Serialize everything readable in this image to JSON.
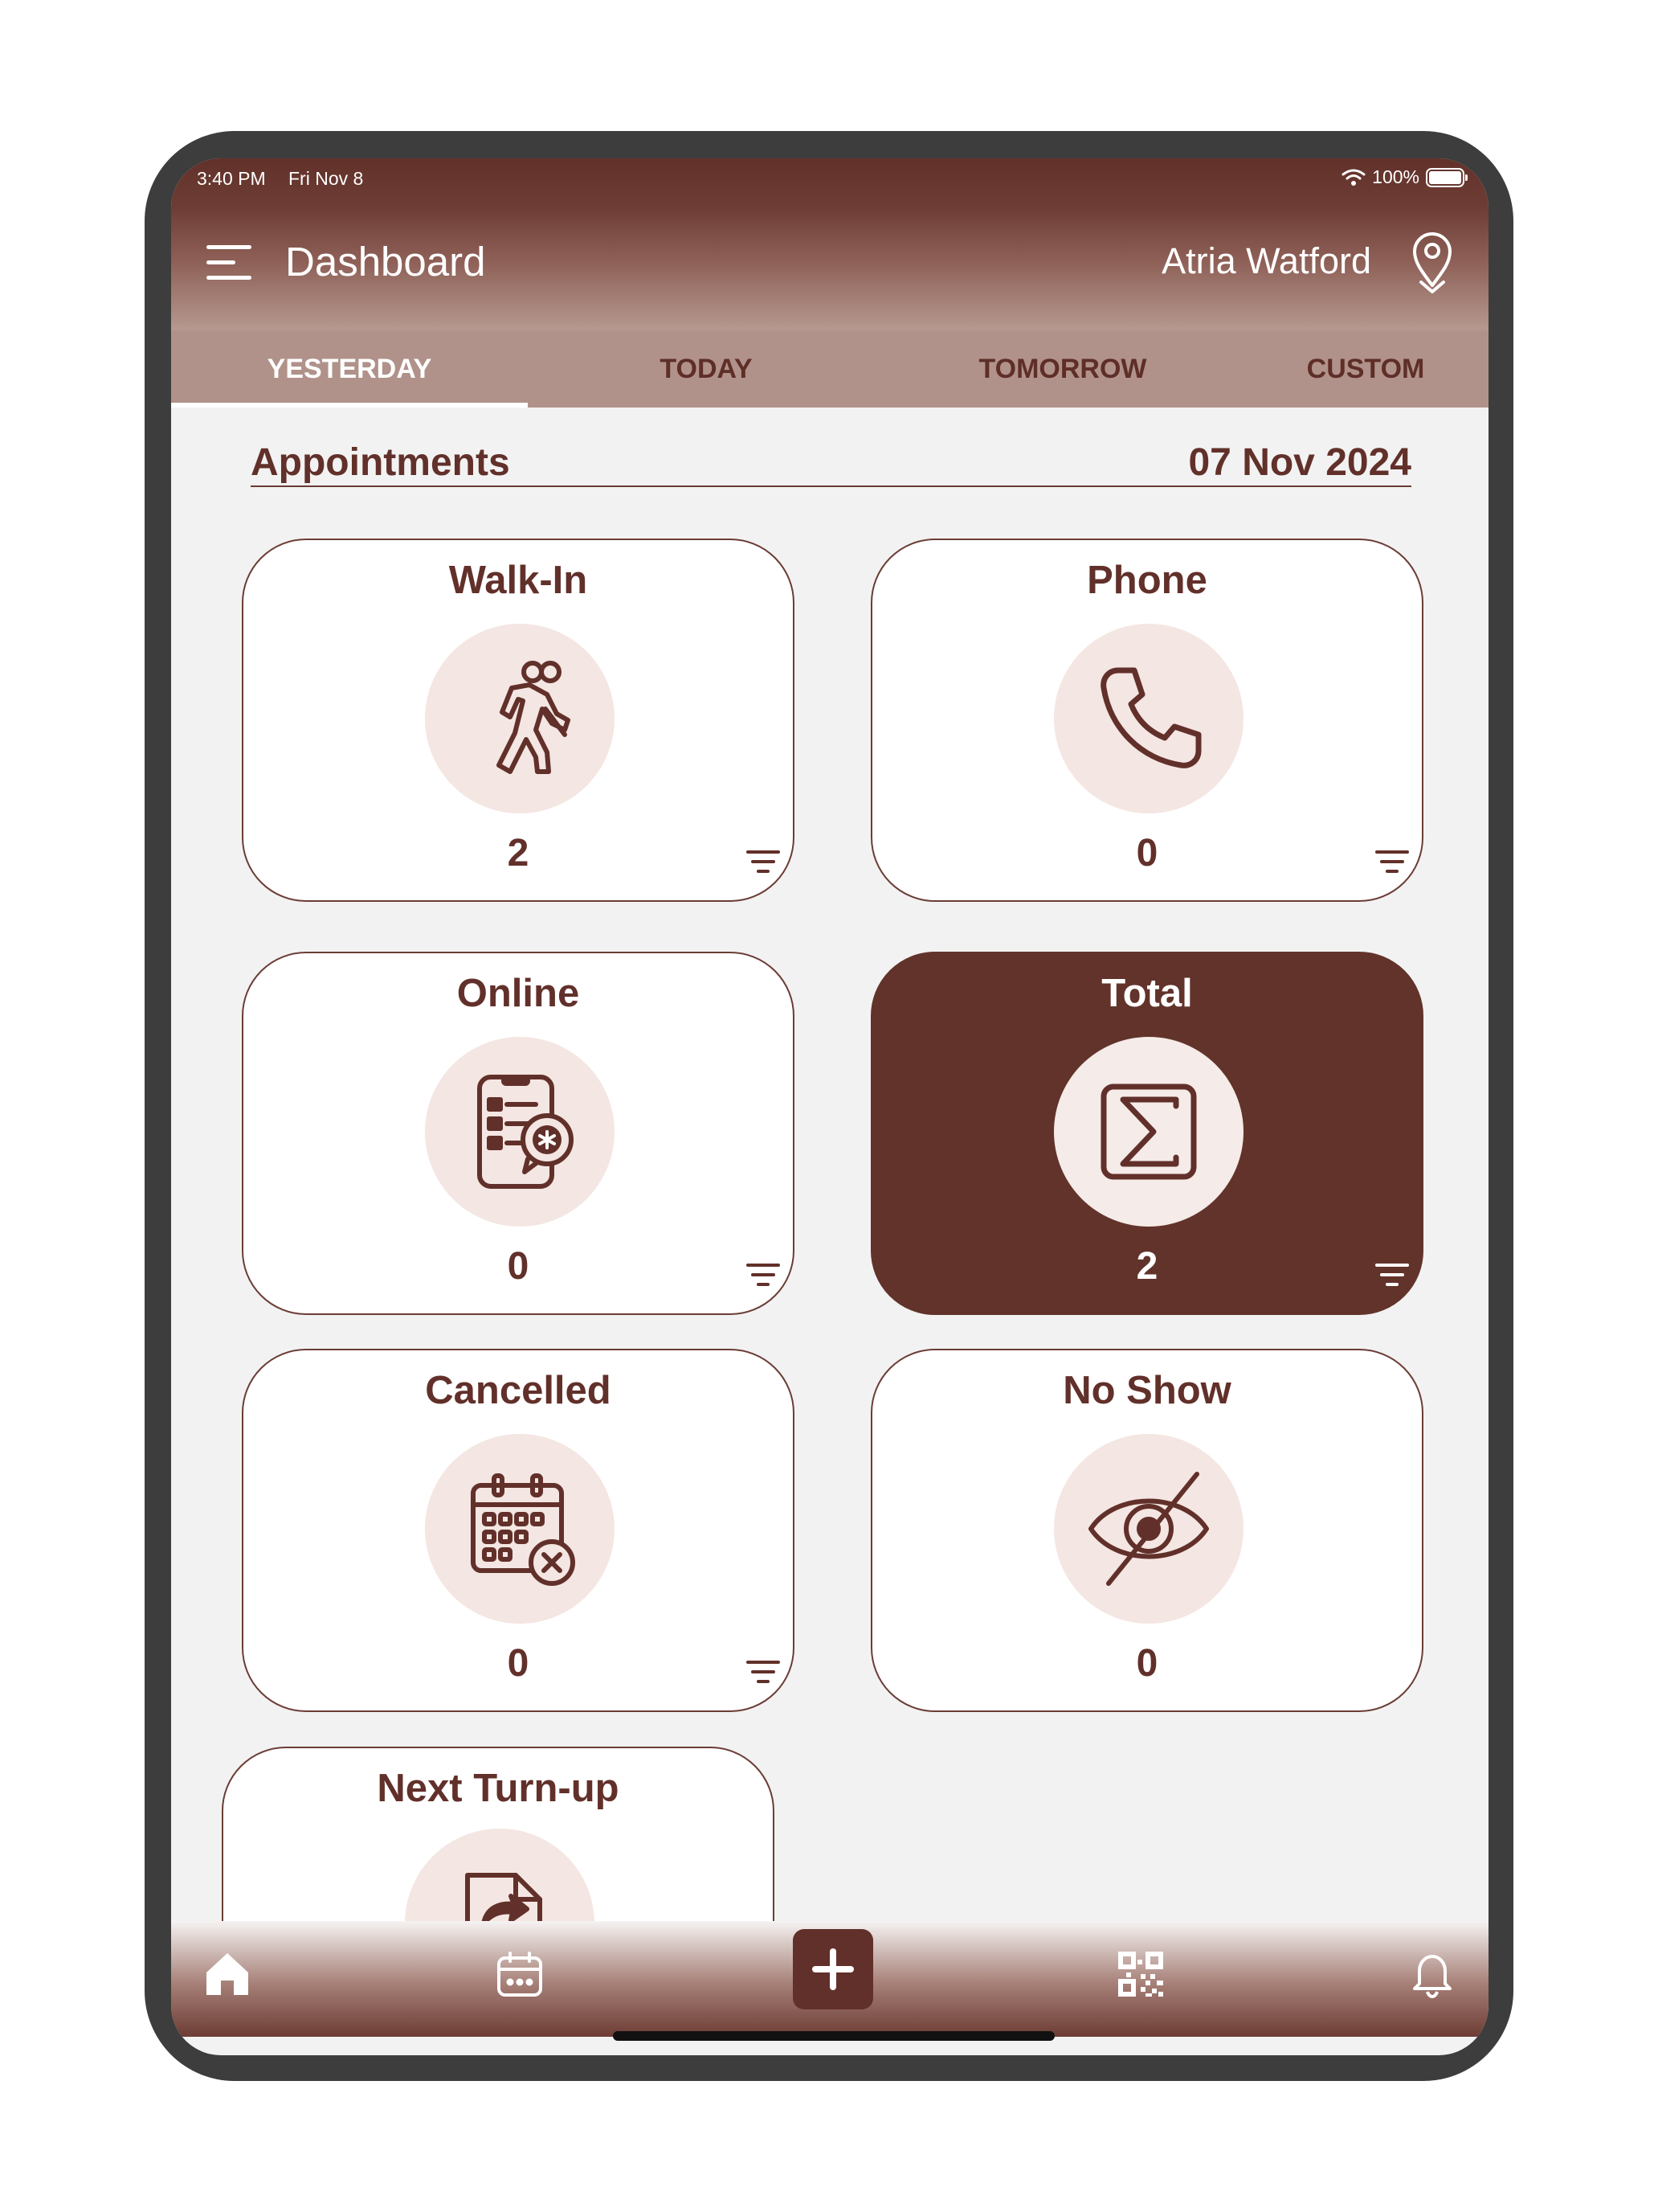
{
  "status": {
    "time": "3:40 PM",
    "date": "Fri Nov 8",
    "battery": "100%"
  },
  "header": {
    "title": "Dashboard",
    "user": "Atria Watford"
  },
  "tabs": [
    {
      "label": "YESTERDAY"
    },
    {
      "label": "TODAY"
    },
    {
      "label": "TOMORROW"
    },
    {
      "label": "CUSTOM"
    }
  ],
  "section": {
    "title": "Appointments",
    "date": "07 Nov 2024"
  },
  "cards": [
    {
      "title": "Walk-In",
      "count": "2",
      "icon": "walk-in-icon"
    },
    {
      "title": "Phone",
      "count": "0",
      "icon": "phone-icon"
    },
    {
      "title": "Online",
      "count": "0",
      "icon": "online-booking-icon"
    },
    {
      "title": "Total",
      "count": "2",
      "icon": "sigma-icon"
    },
    {
      "title": "Cancelled",
      "count": "0",
      "icon": "calendar-cancel-icon"
    },
    {
      "title": "No Show",
      "count": "0",
      "icon": "eye-off-icon"
    },
    {
      "title": "Next Turn-up",
      "icon": "next-turn-icon"
    }
  ],
  "bottom_nav": [
    "home-icon",
    "calendar-icon",
    "add-icon",
    "qr-code-icon",
    "bell-icon"
  ],
  "colors": {
    "primary": "#62302a",
    "tab_bg": "#b0928a",
    "icon_bg": "#f4e6e2",
    "screen_bg": "#f2f2f2"
  }
}
